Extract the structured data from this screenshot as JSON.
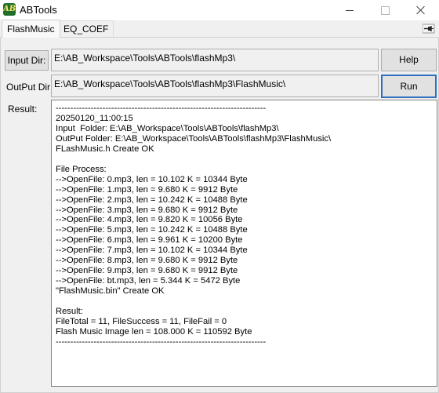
{
  "window": {
    "title": "ABTools",
    "icon_label": "AB"
  },
  "tabs": [
    {
      "label": "FlashMusic"
    },
    {
      "label": "EQ_COEF"
    }
  ],
  "form": {
    "input_dir_button": "Input Dir:",
    "input_dir_value": "E:\\AB_Workspace\\Tools\\ABTools\\flashMp3\\",
    "output_dir_label": "OutPut Dir:",
    "output_dir_value": "E:\\AB_Workspace\\Tools\\ABTools\\flashMp3\\FlashMusic\\",
    "help_button": "Help",
    "run_button": "Run",
    "result_label": "Result:"
  },
  "result_lines": [
    "------------------------------------------------------------------------",
    "20250120_11:00:15",
    "Input  Folder: E:\\AB_Workspace\\Tools\\ABTools\\flashMp3\\",
    "OutPut Folder: E:\\AB_Workspace\\Tools\\ABTools\\flashMp3\\FlashMusic\\",
    "FLashMusic.h Create OK",
    "",
    "File Process:",
    "-->OpenFile: 0.mp3, len = 10.102 K = 10344 Byte",
    "-->OpenFile: 1.mp3, len = 9.680 K = 9912 Byte",
    "-->OpenFile: 2.mp3, len = 10.242 K = 10488 Byte",
    "-->OpenFile: 3.mp3, len = 9.680 K = 9912 Byte",
    "-->OpenFile: 4.mp3, len = 9.820 K = 10056 Byte",
    "-->OpenFile: 5.mp3, len = 10.242 K = 10488 Byte",
    "-->OpenFile: 6.mp3, len = 9.961 K = 10200 Byte",
    "-->OpenFile: 7.mp3, len = 10.102 K = 10344 Byte",
    "-->OpenFile: 8.mp3, len = 9.680 K = 9912 Byte",
    "-->OpenFile: 9.mp3, len = 9.680 K = 9912 Byte",
    "-->OpenFile: bt.mp3, len = 5.344 K = 5472 Byte",
    "\"FlashMusic.bin\" Create OK",
    "",
    "Result:",
    "FileTotal = 11, FileSuccess = 11, FileFail = 0",
    "Flash Music Image len = 108.000 K = 110592 Byte",
    "------------------------------------------------------------------------"
  ]
}
